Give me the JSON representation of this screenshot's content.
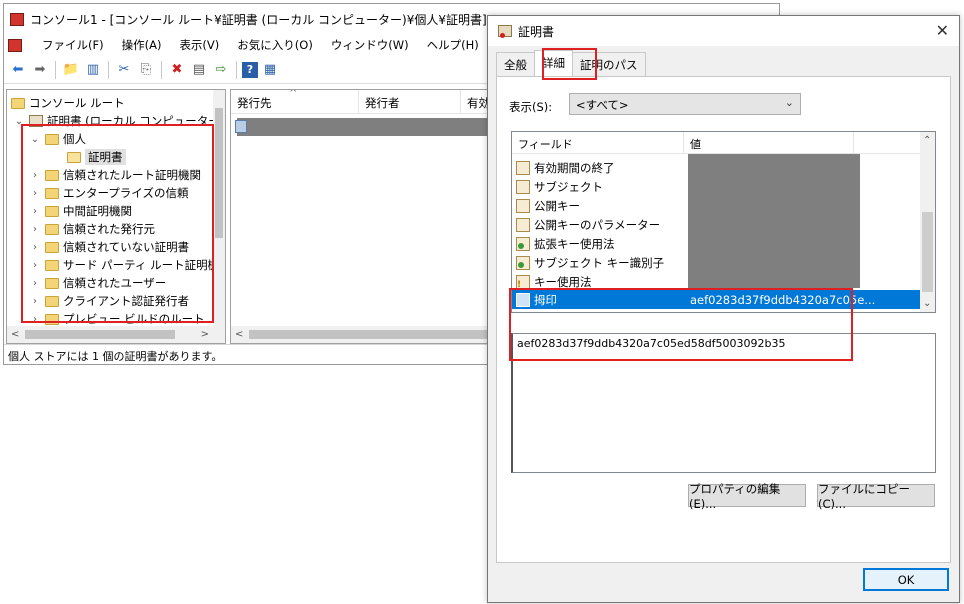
{
  "mmc": {
    "title": "コンソール1 - [コンソール ルート¥証明書 (ローカル コンピューター)¥個人¥証明書]",
    "menu": [
      "ファイル(F)",
      "操作(A)",
      "表示(V)",
      "お気に入り(O)",
      "ウィンドウ(W)",
      "ヘルプ(H)"
    ],
    "tree": {
      "root": "コンソール ルート",
      "computer": "証明書 (ローカル コンピューター)",
      "personal": "個人",
      "certs": "証明書",
      "stores": [
        "信頼されたルート証明機関",
        "エンタープライズの信頼",
        "中間証明機関",
        "信頼された発行元",
        "信頼されていない証明書",
        "サード パーティ ルート証明機関",
        "信頼されたユーザー",
        "クライアント認証発行者",
        "プレビュー ビルドのルート"
      ]
    },
    "list_columns": [
      "発行先",
      "発行者",
      "有効"
    ],
    "status": "個人 ストアには 1 個の証明書があります。"
  },
  "dialog": {
    "title": "証明書",
    "tabs": [
      "全般",
      "詳細",
      "証明のパス"
    ],
    "active_tab": "詳細",
    "show_label": "表示(S):",
    "show_value": "<すべて>",
    "field_col": "フィールド",
    "value_col": "値",
    "fields": [
      {
        "name": "有効期間の終了",
        "icon": "cert-field-icon"
      },
      {
        "name": "サブジェクト",
        "icon": "cert-field-icon"
      },
      {
        "name": "公開キー",
        "icon": "cert-field-icon"
      },
      {
        "name": "公開キーのパラメーター",
        "icon": "cert-field-icon"
      },
      {
        "name": "拡張キー使用法",
        "icon": "extension-icon"
      },
      {
        "name": "サブジェクト キー識別子",
        "icon": "extension-icon"
      },
      {
        "name": "キー使用法",
        "icon": "critical-extension-icon"
      }
    ],
    "selected_field": {
      "name": "拇印",
      "value": "aef0283d37f9ddb4320a7c05e..."
    },
    "value_text": "aef0283d37f9ddb4320a7c05ed58df5003092b35",
    "edit_button": "プロパティの編集(E)...",
    "copy_button": "ファイルにコピー(C)...",
    "ok_button": "OK",
    "colors": {
      "selection": "#0078d7",
      "highlight": "#e02020"
    }
  }
}
